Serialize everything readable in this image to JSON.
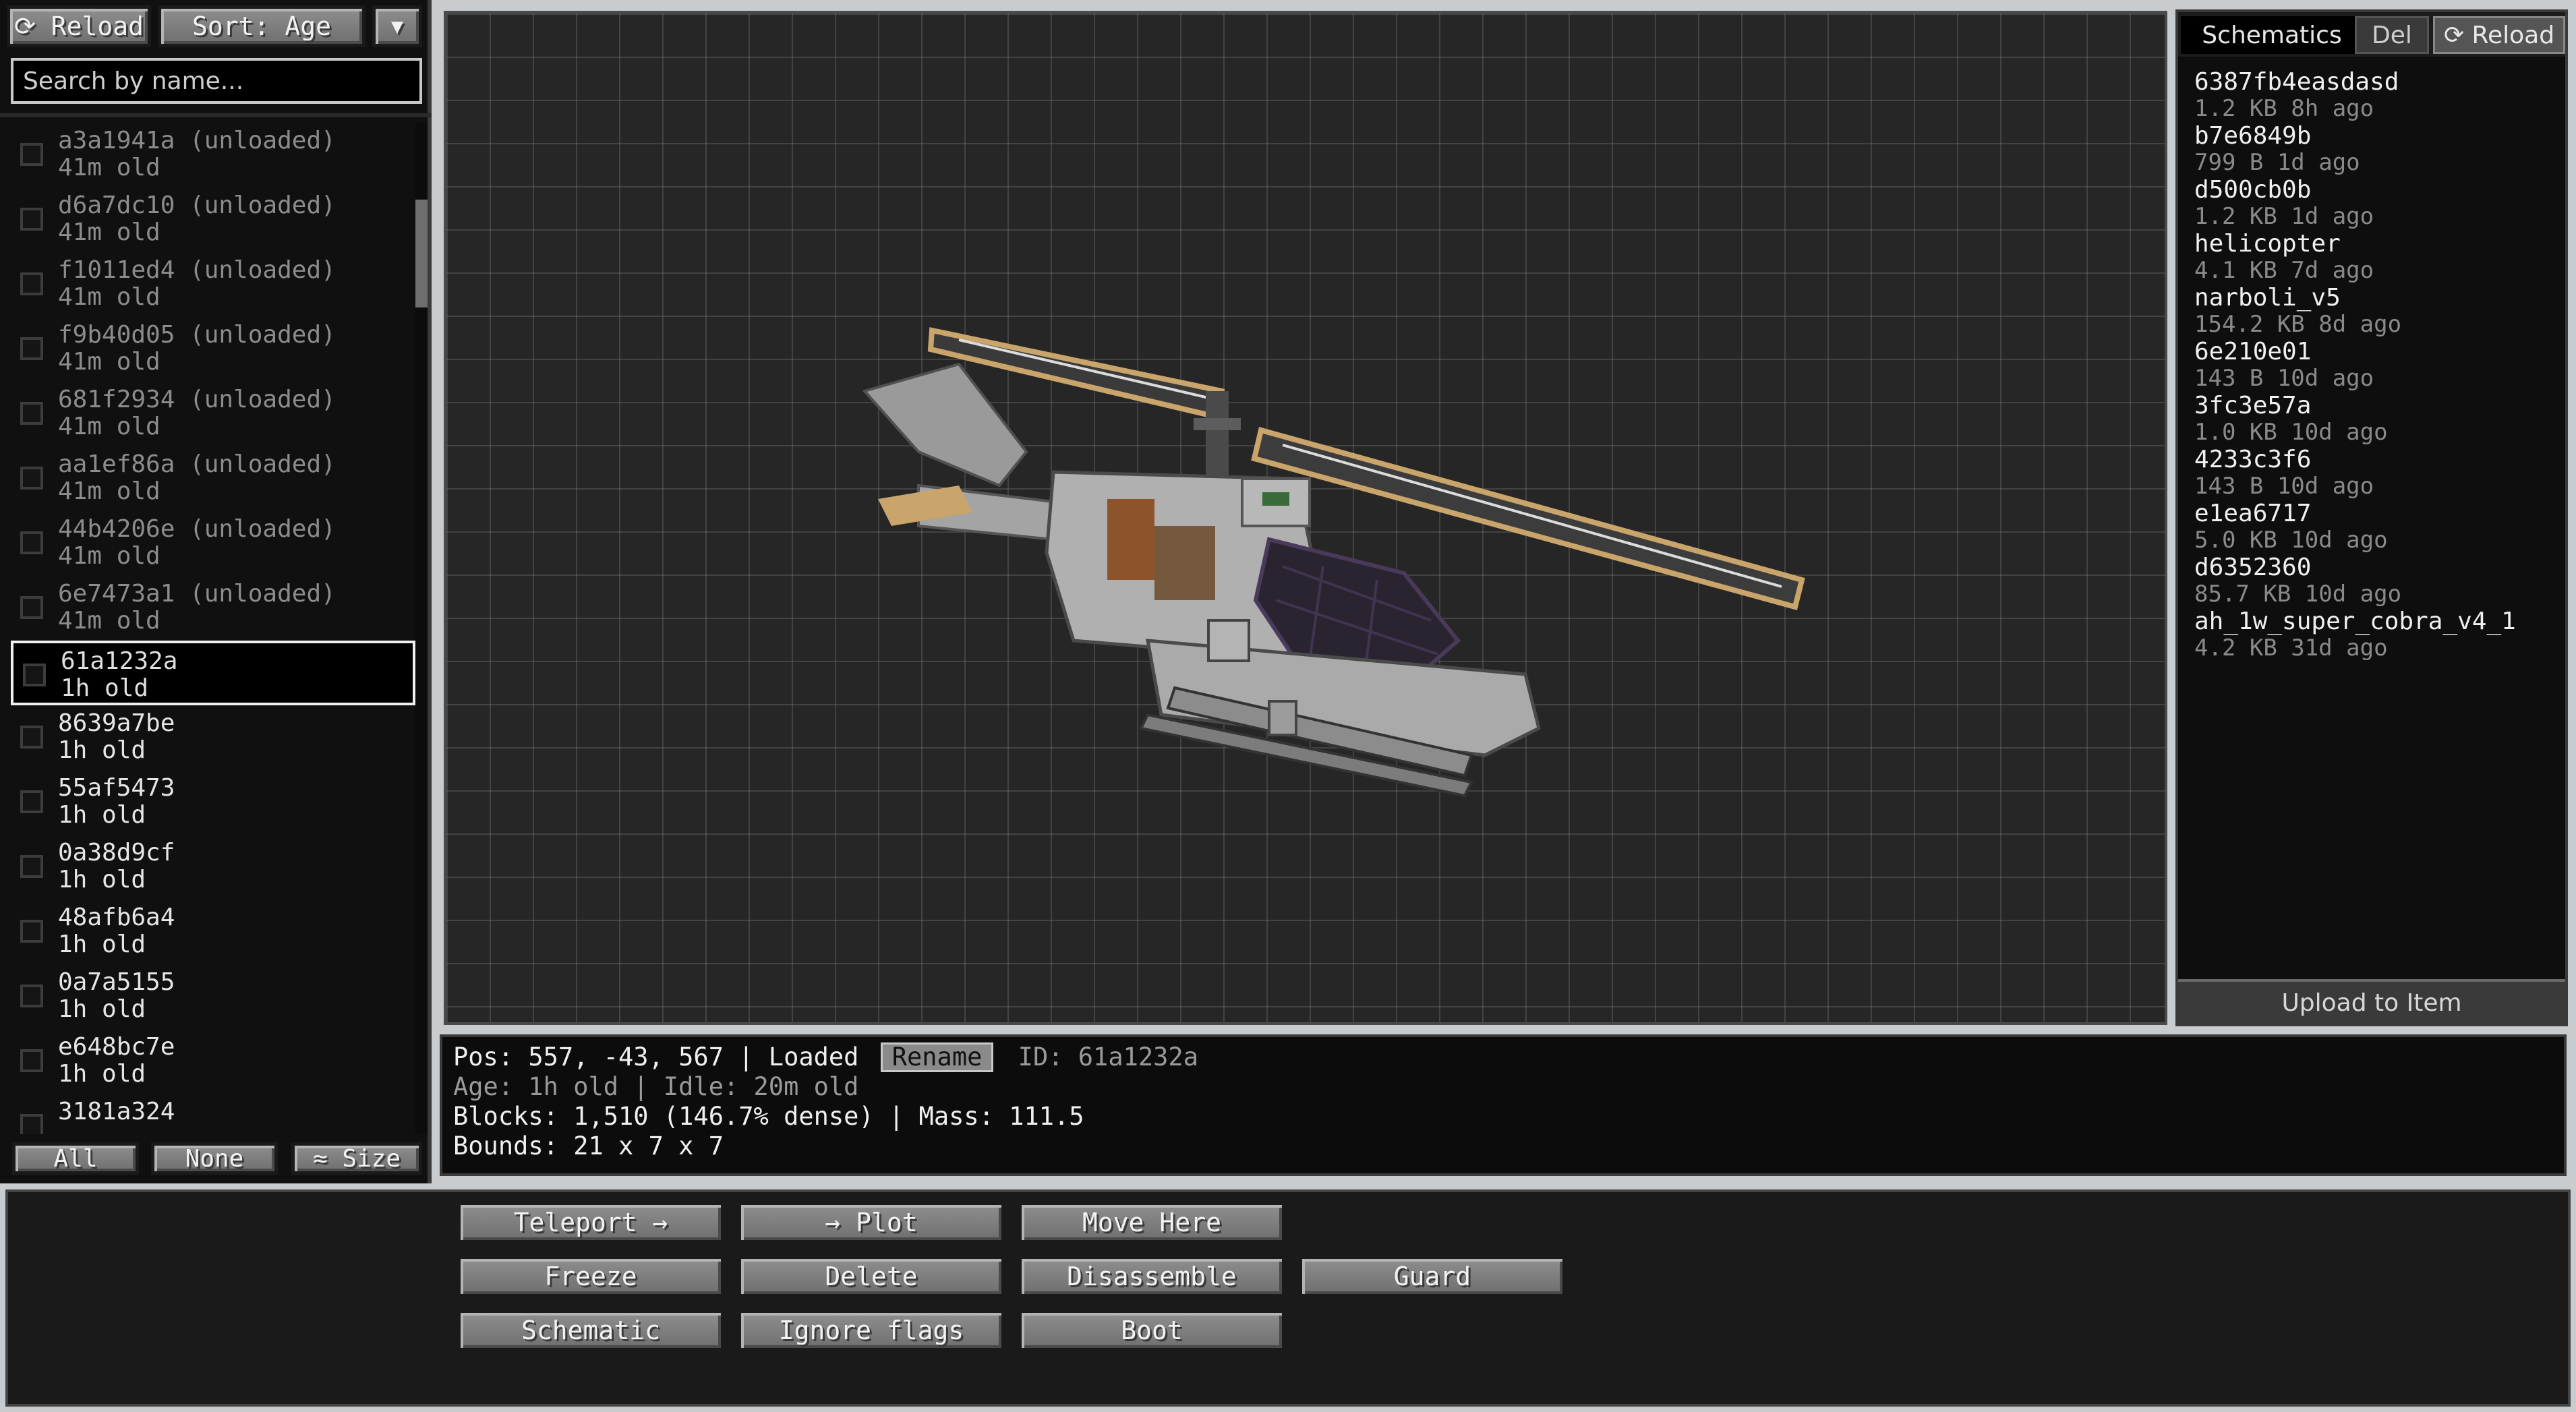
{
  "left_panel": {
    "reload_label": "⟳ Reload",
    "sort_label": "Sort: Age",
    "sort_toggle": "▼",
    "search_placeholder": "Search by name...",
    "crafts": [
      {
        "name": "a3a1941a (unloaded)",
        "age": "41m old",
        "state": "unloaded"
      },
      {
        "name": "d6a7dc10 (unloaded)",
        "age": "41m old",
        "state": "unloaded"
      },
      {
        "name": "f1011ed4 (unloaded)",
        "age": "41m old",
        "state": "unloaded"
      },
      {
        "name": "f9b40d05 (unloaded)",
        "age": "41m old",
        "state": "unloaded"
      },
      {
        "name": "681f2934 (unloaded)",
        "age": "41m old",
        "state": "unloaded"
      },
      {
        "name": "aa1ef86a (unloaded)",
        "age": "41m old",
        "state": "unloaded"
      },
      {
        "name": "44b4206e (unloaded)",
        "age": "41m old",
        "state": "unloaded"
      },
      {
        "name": "6e7473a1 (unloaded)",
        "age": "41m old",
        "state": "unloaded"
      },
      {
        "name": "61a1232a",
        "age": "1h old",
        "state": "selected"
      },
      {
        "name": "8639a7be",
        "age": "1h old",
        "state": "loaded"
      },
      {
        "name": "55af5473",
        "age": "1h old",
        "state": "loaded"
      },
      {
        "name": "0a38d9cf",
        "age": "1h old",
        "state": "loaded"
      },
      {
        "name": "48afb6a4",
        "age": "1h old",
        "state": "loaded"
      },
      {
        "name": "0a7a5155",
        "age": "1h old",
        "state": "loaded"
      },
      {
        "name": "e648bc7e",
        "age": "1h old",
        "state": "loaded"
      },
      {
        "name": "3181a324",
        "age": "",
        "state": "loaded"
      }
    ],
    "footer": {
      "all": "All",
      "none": "None",
      "size": "≈ Size"
    }
  },
  "right_panel": {
    "tab_schematics": "Schematics",
    "tab_del": "Del",
    "tab_reload": "⟳ Reload",
    "schematics": [
      {
        "name": "6387fb4easdasd",
        "info": "1.2 KB  8h ago"
      },
      {
        "name": "b7e6849b",
        "info": "799 B  1d ago"
      },
      {
        "name": "d500cb0b",
        "info": "1.2 KB  1d ago"
      },
      {
        "name": "helicopter",
        "info": "4.1 KB  7d ago"
      },
      {
        "name": "narboli_v5",
        "info": "154.2 KB  8d ago"
      },
      {
        "name": "6e210e01",
        "info": "143 B  10d ago"
      },
      {
        "name": "3fc3e57a",
        "info": "1.0 KB  10d ago"
      },
      {
        "name": "4233c3f6",
        "info": "143 B  10d ago"
      },
      {
        "name": "e1ea6717",
        "info": "5.0 KB  10d ago"
      },
      {
        "name": "d6352360",
        "info": "85.7 KB  10d ago"
      },
      {
        "name": "ah_1w_super_cobra_v4_1",
        "info": "4.2 KB  31d ago"
      }
    ],
    "upload_label": "Upload to Item"
  },
  "info": {
    "pos": "Pos: 557, -43, 567  |  Loaded",
    "rename": "Rename",
    "id": "ID: 61a1232a",
    "age_idle": "Age: 1h old  |  Idle: 20m old",
    "blocks_mass": "Blocks: 1,510  (146.7% dense)  |  Mass: 111.5",
    "bounds": "Bounds: 21 x 7 x 7"
  },
  "actions": {
    "teleport": "Teleport →",
    "plot": "→ Plot",
    "move_here": "Move Here",
    "freeze": "Freeze",
    "delete": "Delete",
    "disassemble": "Disassemble",
    "guard": "Guard",
    "schematic": "Schematic",
    "ignore_flags": "Ignore flags",
    "boot": "Boot"
  }
}
